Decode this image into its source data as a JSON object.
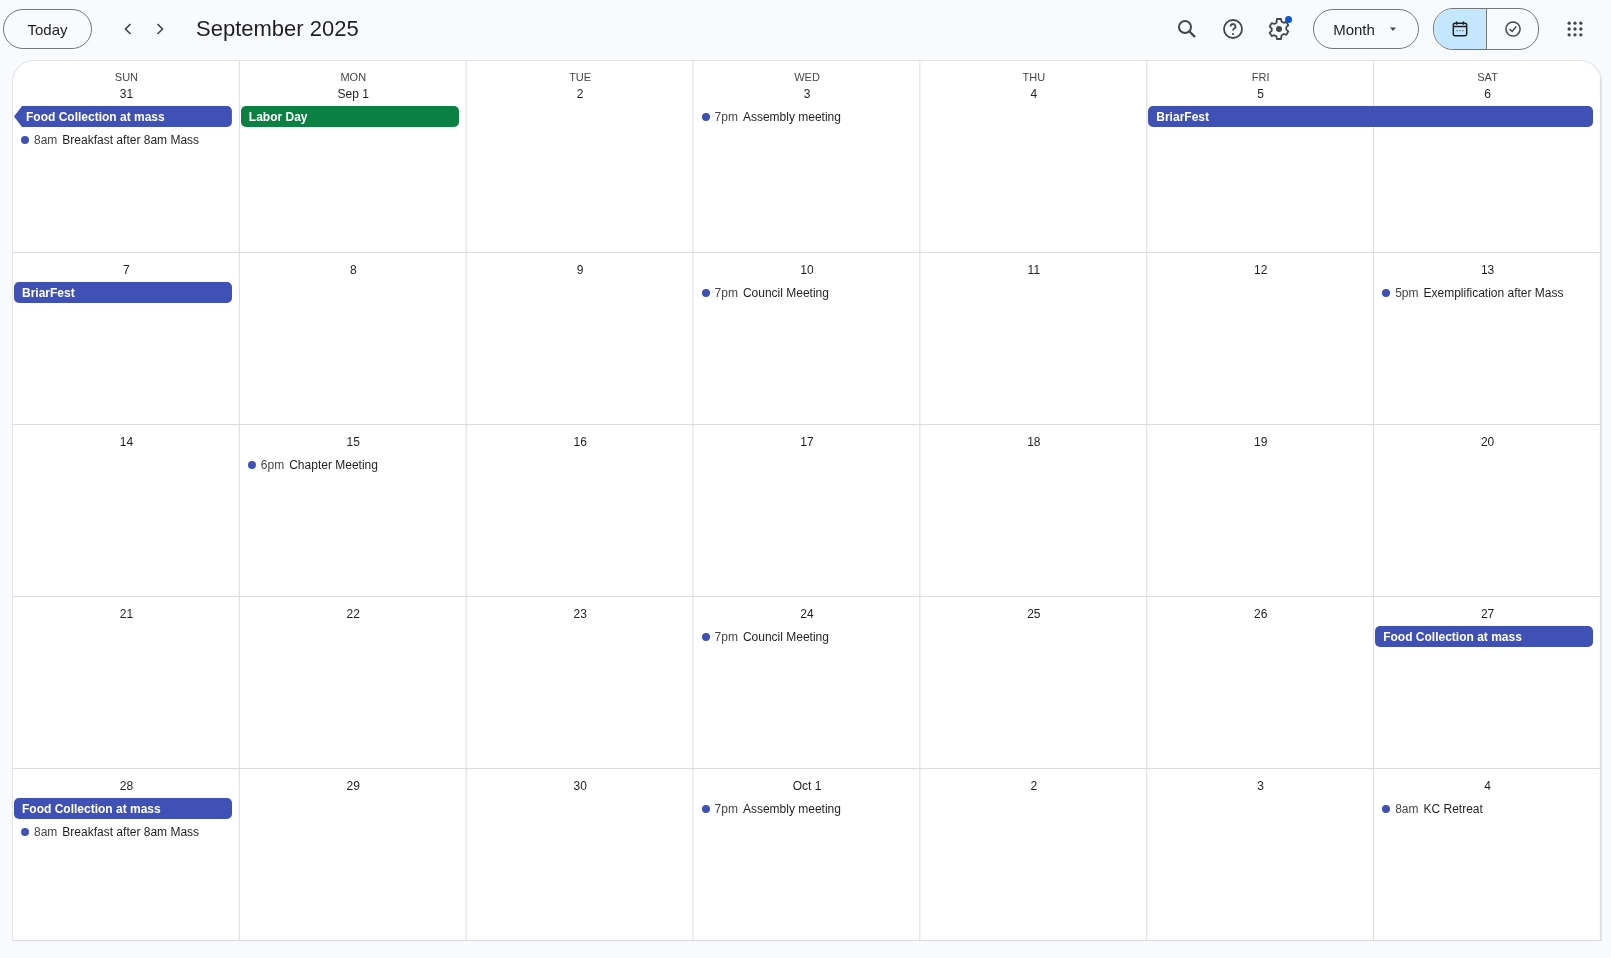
{
  "toolbar": {
    "today": "Today",
    "title": "September 2025",
    "settings_notification": true,
    "view_menu": "Month",
    "views": [
      {
        "kind": "calendar",
        "selected": true
      },
      {
        "kind": "tasks",
        "selected": false
      }
    ]
  },
  "weekdays": [
    "SUN",
    "MON",
    "TUE",
    "WED",
    "THU",
    "FRI",
    "SAT"
  ],
  "weeks": [
    {
      "days": [
        {
          "date": "31",
          "events": [
            {
              "kind": "allday",
              "title": "Food Collection at mass",
              "color": "#3f51b5",
              "continues_left": true
            },
            {
              "kind": "timed",
              "time": "8am",
              "title": "Breakfast after 8am Mass",
              "color": "#3f51b5"
            }
          ]
        },
        {
          "date": "Sep 1",
          "events": [
            {
              "kind": "allday",
              "title": "Labor Day",
              "color": "#0b8043",
              "continues_left": false
            }
          ]
        },
        {
          "date": "2"
        },
        {
          "date": "3",
          "events": [
            {
              "kind": "timed",
              "time": "7pm",
              "title": "Assembly meeting",
              "color": "#3f51b5"
            }
          ]
        },
        {
          "date": "4"
        },
        {
          "date": "5",
          "events": [
            {
              "kind": "allday",
              "title": "BriarFest",
              "color": "#3f51b5",
              "continues_left": false,
              "spans_next_day": true
            }
          ]
        },
        {
          "date": "6"
        }
      ]
    },
    {
      "days": [
        {
          "date": "7",
          "events": [
            {
              "kind": "allday",
              "title": "BriarFest",
              "color": "#3f51b5",
              "continues_left": false
            }
          ]
        },
        {
          "date": "8"
        },
        {
          "date": "9"
        },
        {
          "date": "10",
          "events": [
            {
              "kind": "timed",
              "time": "7pm",
              "title": "Council Meeting",
              "color": "#3f51b5"
            }
          ]
        },
        {
          "date": "11"
        },
        {
          "date": "12"
        },
        {
          "date": "13",
          "events": [
            {
              "kind": "timed",
              "time": "5pm",
              "title": "Exemplification after Mass",
              "color": "#3f51b5"
            }
          ]
        }
      ]
    },
    {
      "days": [
        {
          "date": "14"
        },
        {
          "date": "15",
          "events": [
            {
              "kind": "timed",
              "time": "6pm",
              "title": "Chapter Meeting",
              "color": "#3f51b5"
            }
          ]
        },
        {
          "date": "16"
        },
        {
          "date": "17"
        },
        {
          "date": "18"
        },
        {
          "date": "19"
        },
        {
          "date": "20"
        }
      ]
    },
    {
      "days": [
        {
          "date": "21"
        },
        {
          "date": "22"
        },
        {
          "date": "23"
        },
        {
          "date": "24",
          "events": [
            {
              "kind": "timed",
              "time": "7pm",
              "title": "Council Meeting",
              "color": "#3f51b5"
            }
          ]
        },
        {
          "date": "25"
        },
        {
          "date": "26"
        },
        {
          "date": "27",
          "events": [
            {
              "kind": "allday",
              "title": "Food Collection at mass",
              "color": "#3f51b5",
              "continues_left": false
            }
          ]
        }
      ]
    },
    {
      "days": [
        {
          "date": "28",
          "events": [
            {
              "kind": "allday",
              "title": "Food Collection at mass",
              "color": "#3f51b5",
              "continues_left": false
            },
            {
              "kind": "timed",
              "time": "8am",
              "title": "Breakfast after 8am Mass",
              "color": "#3f51b5"
            }
          ]
        },
        {
          "date": "29"
        },
        {
          "date": "30"
        },
        {
          "date": "Oct 1",
          "events": [
            {
              "kind": "timed",
              "time": "7pm",
              "title": "Assembly meeting",
              "color": "#3f51b5"
            }
          ]
        },
        {
          "date": "2"
        },
        {
          "date": "3"
        },
        {
          "date": "4",
          "events": [
            {
              "kind": "timed",
              "time": "8am",
              "title": "KC Retreat",
              "color": "#3f51b5"
            }
          ]
        }
      ]
    }
  ]
}
